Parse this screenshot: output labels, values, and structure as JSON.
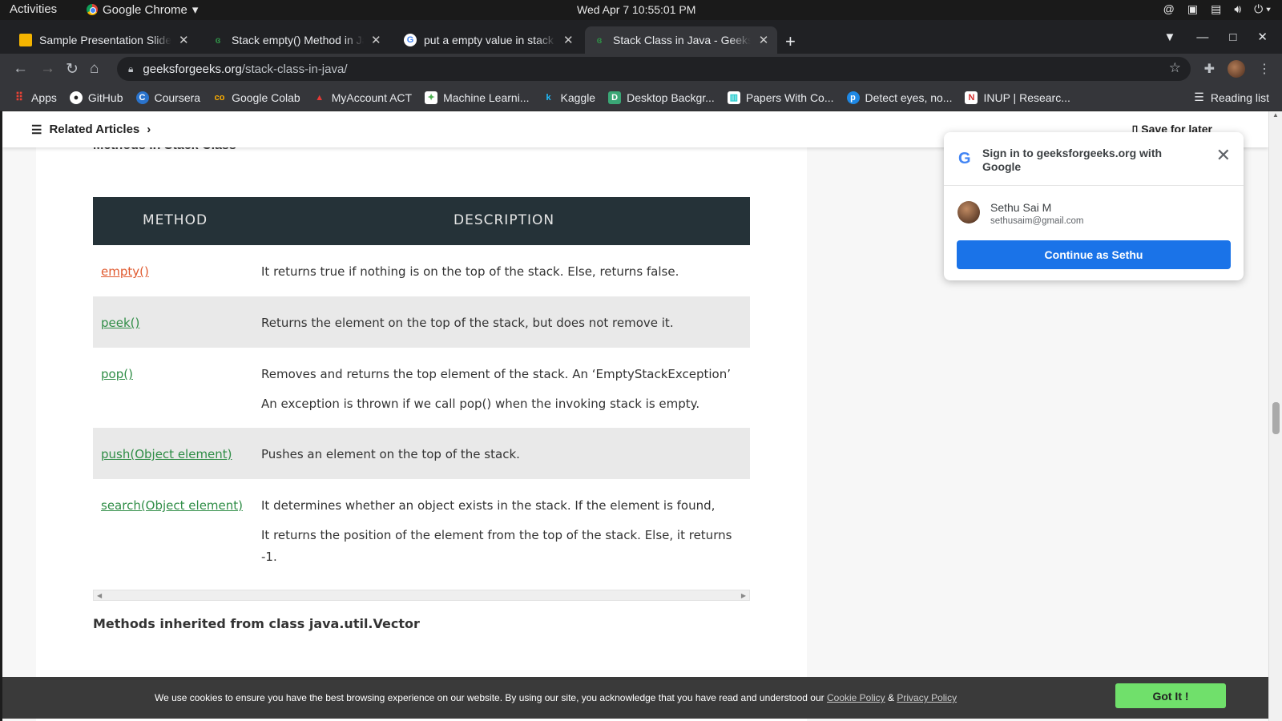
{
  "system": {
    "activities": "Activities",
    "app_name": "Google Chrome",
    "clock": "Wed Apr 7  10:55:01 PM"
  },
  "tabs": [
    {
      "title": "Sample Presentation Slides",
      "favicon": "slides-icon"
    },
    {
      "title": "Stack empty() Method in Java",
      "favicon": "gfg-icon"
    },
    {
      "title": "put a empty value in stack",
      "favicon": "google-icon"
    },
    {
      "title": "Stack Class in Java - GeeksforGeeks",
      "favicon": "gfg-icon"
    }
  ],
  "address": {
    "host": "geeksforgeeks.org",
    "path": "/stack-class-in-java/"
  },
  "bookmarks": [
    {
      "label": "Apps",
      "icon": "apps-grid-icon",
      "color": "#e94235"
    },
    {
      "label": "GitHub",
      "icon": "github-icon",
      "color": "#ffffff"
    },
    {
      "label": "Coursera",
      "icon": "coursera-icon",
      "color": "#2a73cc"
    },
    {
      "label": "Google Colab",
      "icon": "colab-icon",
      "color": "#f9ab00"
    },
    {
      "label": "MyAccount ACT",
      "icon": "act-icon",
      "color": "#e53935"
    },
    {
      "label": "Machine Learni...",
      "icon": "ml-icon",
      "color": "#ffffff"
    },
    {
      "label": "Kaggle",
      "icon": "kaggle-icon",
      "color": "#20beff"
    },
    {
      "label": "Desktop Backgr...",
      "icon": "desktop-icon",
      "color": "#3aa776"
    },
    {
      "label": "Papers With Co...",
      "icon": "paperswithcode-icon",
      "color": "#21cbce"
    },
    {
      "label": "Detect eyes, no...",
      "icon": "pyimagesearch-icon",
      "color": "#1e88e5"
    },
    {
      "label": "INUP  |  Researc...",
      "icon": "inup-icon",
      "color": "#d32f2f"
    }
  ],
  "reading_list": "Reading list",
  "related": {
    "label": "Related Articles",
    "save": "Save for later"
  },
  "section_heading": "Methods in Stack Class",
  "table": {
    "headers": [
      "METHOD",
      "DESCRIPTION"
    ],
    "rows": [
      {
        "method": "empty()",
        "desc": [
          "It returns true if nothing is on the top of the stack. Else, returns false."
        ]
      },
      {
        "method": "peek()",
        "desc": [
          "Returns the element on the top of the stack, but does not remove it."
        ]
      },
      {
        "method": "pop()",
        "desc": [
          "Removes and returns the top element of the stack. An ‘EmptyStackException’",
          "An exception is thrown if we call pop() when the invoking stack is empty."
        ]
      },
      {
        "method": "push(Object element)",
        "desc": [
          "Pushes an element on the top of the stack."
        ]
      },
      {
        "method": "search(Object element)",
        "desc": [
          "It determines whether an object exists in the stack. If the element is found,",
          "It returns the position of the element from the top of the stack. Else, it returns -1."
        ]
      }
    ]
  },
  "inherited_heading": "Methods inherited from class java.util.Vector",
  "onetap": {
    "title": "Sign in to geeksforgeeks.org with Google",
    "name": "Sethu Sai M",
    "email": "sethusaim@gmail.com",
    "button": "Continue as Sethu"
  },
  "cookie": {
    "message": "We use cookies to ensure you have the best browsing experience on our website. By using our site, you acknowledge that you have read and understood our",
    "cookie_policy": "Cookie Policy",
    "amp": "&",
    "privacy_policy": "Privacy Policy",
    "button": "Got It !"
  },
  "colors": {
    "link_green": "#2f8d46",
    "link_visited": "#e05a2f",
    "table_header": "#253238",
    "google_blue": "#1a73e8",
    "cookie_button": "#70e06b"
  }
}
